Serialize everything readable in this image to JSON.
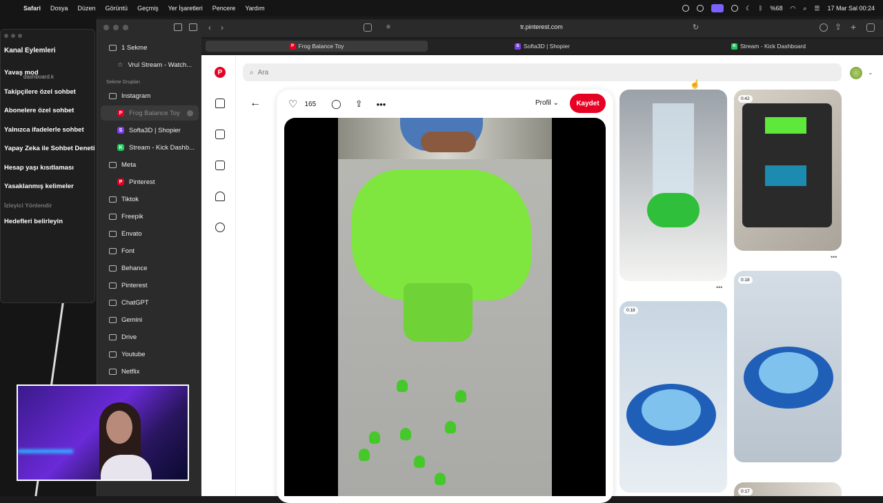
{
  "menubar": {
    "app": "Safari",
    "items": [
      "Dosya",
      "Düzen",
      "Görüntü",
      "Geçmiş",
      "Yer İşaretleri",
      "Pencere",
      "Yardım"
    ],
    "battery": "%68",
    "datetime": "17 Mar Sal  00:24"
  },
  "kick_panel": {
    "tab": "dashboard.k",
    "title": "Kanal Eylemleri",
    "items": [
      "Yavaş mod",
      "Takipçilere özel sohbet",
      "Abonelere özel sohbet",
      "Yalnızca ifadelerle sohbet",
      "Yapay Zeka ile Sohbet Denetimi",
      "Hesap yaşı kısıtlaması",
      "Yasaklanmış kelimeler",
      "İzleyici Yönlendir",
      "Hedefleri belirleyin"
    ]
  },
  "sidebar": {
    "tabs_count": "1 Sekme",
    "pinned": "Vrul Stream - Watch...",
    "section_label": "Sekme Grupları",
    "groups": [
      {
        "label": "Instagram"
      },
      {
        "label": "Frog Balance Toy",
        "child": true,
        "dim": true,
        "fav": "P",
        "color": "#e60023"
      },
      {
        "label": "Softa3D | Shopier",
        "child": true,
        "fav": "S",
        "color": "#7b3fe4"
      },
      {
        "label": "Stream - Kick Dashb...",
        "child": true,
        "fav": "K",
        "color": "#22c55e"
      },
      {
        "label": "Meta"
      },
      {
        "label": "Pinterest",
        "child": true,
        "fav": "P",
        "color": "#e60023"
      },
      {
        "label": "Tiktok"
      },
      {
        "label": "Freepik"
      },
      {
        "label": "Envato"
      },
      {
        "label": "Font"
      },
      {
        "label": "Behance"
      },
      {
        "label": "Pinterest"
      },
      {
        "label": "ChatGPT"
      },
      {
        "label": "Gemini"
      },
      {
        "label": "Drive"
      },
      {
        "label": "Youtube"
      },
      {
        "label": "Netflix"
      }
    ]
  },
  "toolbar": {
    "back": "‹",
    "forward": "›",
    "address": "tr.pinterest.com"
  },
  "tabs": [
    {
      "label": "Frog Balance Toy",
      "fav": "P",
      "color": "#e60023"
    },
    {
      "label": "Softa3D | Shopier",
      "fav": "S",
      "color": "#7b3fe4"
    },
    {
      "label": "Stream - Kick Dashboard",
      "fav": "K",
      "color": "#22c55e"
    }
  ],
  "pinterest": {
    "logo": "P",
    "search_placeholder": "Ara",
    "likes": "165",
    "profile_label": "Profil",
    "save_label": "Kaydet",
    "thumbs": [
      {
        "badge": ""
      },
      {
        "badge": "0:42"
      },
      {
        "badge": "0:18"
      },
      {
        "badge": "0:18"
      },
      {
        "badge": "0:17"
      }
    ]
  },
  "icons": {
    "heart": "heart-icon",
    "comment": "comment-icon",
    "share": "share-icon",
    "more": "more-icon"
  }
}
